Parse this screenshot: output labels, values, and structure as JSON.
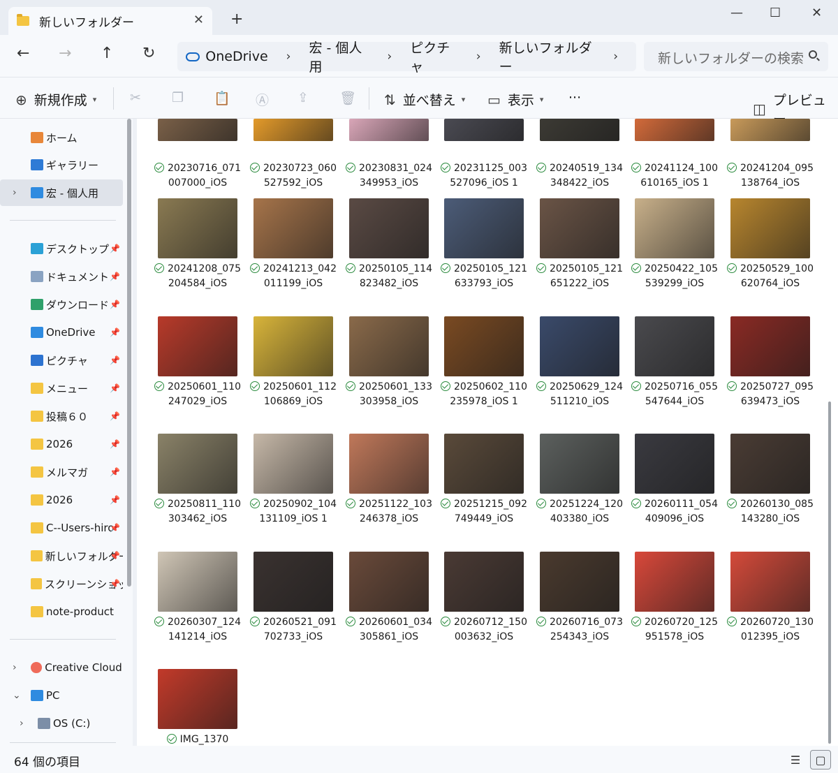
{
  "window": {
    "tab_title": "新しいフォルダー",
    "tab_close": "✕",
    "new_tab": "+",
    "minimize": "—",
    "maximize": "☐",
    "close": "✕"
  },
  "nav": {
    "back": "←",
    "forward": "→",
    "up": "↑",
    "refresh": "↻",
    "breadcrumbs": [
      "OneDrive",
      "宏 - 個人用",
      "ピクチャ",
      "新しいフォルダー"
    ],
    "chevron": "›",
    "search_placeholder": "新しいフォルダーの検索"
  },
  "commands": {
    "new": "新規作成",
    "sort": "並べ替え",
    "view": "表示",
    "more": "···",
    "preview": "プレビュー"
  },
  "sidebar": {
    "items": [
      {
        "label": "ホーム",
        "icon": "home-icon",
        "pinned": false
      },
      {
        "label": "ギャラリー",
        "icon": "gallery-icon",
        "pinned": false
      },
      {
        "label": "宏 - 個人用",
        "icon": "onedrive-folder-icon",
        "pinned": false,
        "selected": true
      },
      {
        "label": "デスクトップ",
        "icon": "desktop-icon",
        "pinned": true
      },
      {
        "label": "ドキュメント",
        "icon": "documents-icon",
        "pinned": true
      },
      {
        "label": "ダウンロード",
        "icon": "download-icon",
        "pinned": true
      },
      {
        "label": "OneDrive",
        "icon": "onedrive-icon",
        "pinned": true
      },
      {
        "label": "ピクチャ",
        "icon": "pictures-icon",
        "pinned": true
      },
      {
        "label": "メニュー",
        "icon": "folder-icon",
        "pinned": true
      },
      {
        "label": "投稿６０",
        "icon": "folder-icon",
        "pinned": true
      },
      {
        "label": "2026",
        "icon": "folder-icon",
        "pinned": true
      },
      {
        "label": "メルマガ",
        "icon": "folder-icon",
        "pinned": true
      },
      {
        "label": "2026",
        "icon": "folder-icon",
        "pinned": true
      },
      {
        "label": "C--Users-hiro",
        "icon": "folder-icon",
        "pinned": true
      },
      {
        "label": "新しいフォルダー",
        "icon": "folder-icon",
        "pinned": true
      },
      {
        "label": "スクリーンショット",
        "icon": "folder-icon",
        "pinned": true
      },
      {
        "label": "note-product",
        "icon": "folder-icon",
        "pinned": false
      },
      {
        "label": "Creative Cloud F",
        "icon": "creative-cloud-icon",
        "pinned": false
      },
      {
        "label": "PC",
        "icon": "pc-icon",
        "pinned": false
      },
      {
        "label": "OS (C:)",
        "icon": "drive-icon",
        "pinned": false
      }
    ]
  },
  "files": [
    {
      "line1": "20230716_071",
      "line2": "007000_iOS",
      "color": "#7a6048"
    },
    {
      "line1": "20230723_060",
      "line2": "527592_iOS",
      "color": "#e39a2a"
    },
    {
      "line1": "20230831_024",
      "line2": "349953_iOS",
      "color": "#d9a6b8"
    },
    {
      "line1": "20231125_003",
      "line2": "527096_iOS 1",
      "color": "#4a4a52"
    },
    {
      "line1": "20240519_134",
      "line2": "348422_iOS",
      "color": "#3c3a34"
    },
    {
      "line1": "20241124_100",
      "line2": "610165_iOS 1",
      "color": "#d26a3a"
    },
    {
      "line1": "20241204_095",
      "line2": "138764_iOS",
      "color": "#c89a5a"
    },
    {
      "line1": "20241208_075",
      "line2": "204584_iOS",
      "color": "#8a7a52"
    },
    {
      "line1": "20241213_042",
      "line2": "011199_iOS",
      "color": "#a6744a"
    },
    {
      "line1": "20250105_114",
      "line2": "823482_iOS",
      "color": "#5a4a44"
    },
    {
      "line1": "20250105_121",
      "line2": "633793_iOS",
      "color": "#4c5c78"
    },
    {
      "line1": "20250105_121",
      "line2": "651222_iOS",
      "color": "#6a5446"
    },
    {
      "line1": "20250422_105",
      "line2": "539299_iOS",
      "color": "#c8b08a"
    },
    {
      "line1": "20250529_100",
      "line2": "620764_iOS",
      "color": "#b8862e"
    },
    {
      "line1": "20250601_110",
      "line2": "247029_iOS",
      "color": "#b83a2a"
    },
    {
      "line1": "20250601_112",
      "line2": "106869_iOS",
      "color": "#d8b43a"
    },
    {
      "line1": "20250601_133",
      "line2": "303958_iOS",
      "color": "#8a6a4a"
    },
    {
      "line1": "20250602_110",
      "line2": "235978_iOS 1",
      "color": "#7a4a22"
    },
    {
      "line1": "20250629_124",
      "line2": "511210_iOS",
      "color": "#3a4a6a"
    },
    {
      "line1": "20250716_055",
      "line2": "547644_iOS",
      "color": "#4a4a4e"
    },
    {
      "line1": "20250727_095",
      "line2": "639473_iOS",
      "color": "#8a2a24"
    },
    {
      "line1": "20250811_110",
      "line2": "303462_iOS",
      "color": "#8a8268"
    },
    {
      "line1": "20250902_104",
      "line2": "131109_iOS 1",
      "color": "#c6b8a8"
    },
    {
      "line1": "20251122_103",
      "line2": "246378_iOS",
      "color": "#c0785a"
    },
    {
      "line1": "20251215_092",
      "line2": "749449_iOS",
      "color": "#5a4a3a"
    },
    {
      "line1": "20251224_120",
      "line2": "403380_iOS",
      "color": "#5c605e"
    },
    {
      "line1": "20260111_054",
      "line2": "409096_iOS",
      "color": "#3a3a40"
    },
    {
      "line1": "20260130_085",
      "line2": "143280_iOS",
      "color": "#4a3c34"
    },
    {
      "line1": "20260307_124",
      "line2": "141214_iOS",
      "color": "#d0c6b6"
    },
    {
      "line1": "20260521_091",
      "line2": "702733_iOS",
      "color": "#3a3230"
    },
    {
      "line1": "20260601_034",
      "line2": "305861_iOS",
      "color": "#6a4a3a"
    },
    {
      "line1": "20260712_150",
      "line2": "003632_iOS",
      "color": "#4a3a34"
    },
    {
      "line1": "20260716_073",
      "line2": "254343_iOS",
      "color": "#4a3a2e"
    },
    {
      "line1": "20260720_125",
      "line2": "951578_iOS",
      "color": "#d8483a"
    },
    {
      "line1": "20260720_130",
      "line2": "012395_iOS",
      "color": "#d44a3a"
    },
    {
      "line1": "IMG_1370",
      "line2": "",
      "color": "#c23a2a"
    }
  ],
  "status": {
    "item_count": "64 個の項目",
    "details_view_icon": "☰",
    "large_icons_view_icon": "▢"
  }
}
